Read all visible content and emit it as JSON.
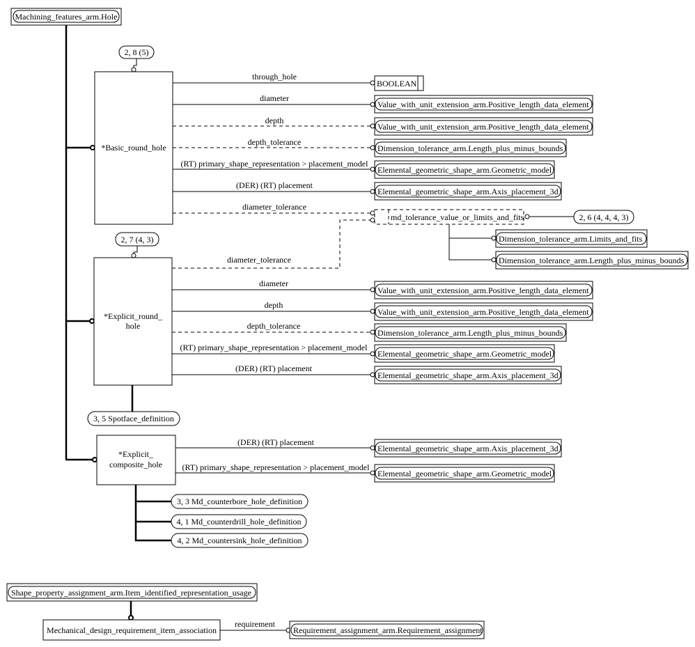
{
  "diagram": {
    "title_entity": "Machining_features_arm.Hole",
    "entities": {
      "basic": "*Basic_round_hole",
      "explicit_l1": "*Explicit_round_",
      "explicit_l2": "hole",
      "composite_l1": "*Explicit_",
      "composite_l2": "composite_hole",
      "select": "md_tolerance_value_or_limits_and_fits",
      "mech_assoc": "Mechanical_design_requirement_item_association",
      "boolean": "BOOLEAN"
    },
    "page_refs": {
      "basic": "2, 8 (5)",
      "explicit": "2, 7 (4, 3)",
      "select": "2, 6 (4, 4, 4, 3)",
      "spotface": "3, 5 Spotface_definition",
      "counterbore": "3, 3 Md_counterbore_hole_definition",
      "counterdrill": "4, 1 Md_counterdrill_hole_definition",
      "countersink": "4, 2 Md_countersink_hole_definition"
    },
    "types": {
      "positive_length": "Value_with_unit_extension_arm.Positive_length_data_element",
      "length_pm": "Dimension_tolerance_arm.Length_plus_minus_bounds",
      "limits_fits": "Dimension_tolerance_arm.Limits_and_fits",
      "geom_model": "Elemental_geometric_shape_arm.Geometric_model",
      "axis_placement": "Elemental_geometric_shape_arm.Axis_placement_3d",
      "item_usage": "Shape_property_assignment_arm.Item_identified_representation_usage",
      "req_assignment": "Requirement_assignment_arm.Requirement_assignment"
    },
    "attributes": {
      "through_hole": "through_hole",
      "diameter": "diameter",
      "depth": "depth",
      "depth_tolerance": "depth_tolerance",
      "primary_shape": "(RT) primary_shape_representation > placement_model",
      "placement": "(DER) (RT) placement",
      "diameter_tolerance": "diameter_tolerance",
      "requirement": "requirement"
    }
  }
}
